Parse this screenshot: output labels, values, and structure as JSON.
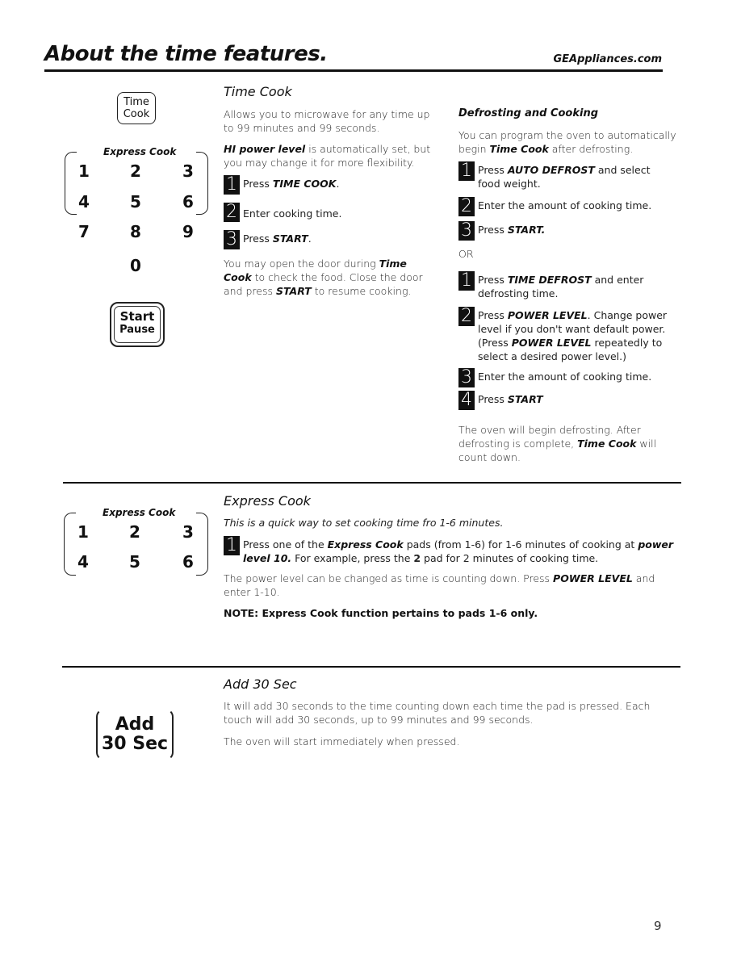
{
  "header": {
    "title": "About the time features.",
    "site": "GEAppliances.com"
  },
  "keypad": {
    "time_cook_button": [
      "Time",
      "Cook"
    ],
    "express_label": "Express Cook",
    "keys": [
      "1",
      "2",
      "3",
      "4",
      "5",
      "6",
      "7",
      "8",
      "9",
      "0"
    ],
    "start_pause_button": [
      "Start",
      "Pause"
    ]
  },
  "time_cook": {
    "heading": "Time Cook",
    "intro": "Allows you to microwave for any time up to 99 minutes and 99 seconds.",
    "power_bold": "HI power level",
    "power_rest": " is automatically set, but you may change it for more flexibility.",
    "steps": [
      {
        "num": "1",
        "pre": "Press ",
        "bold": "TIME COOK",
        "post": "."
      },
      {
        "num": "2",
        "pre": "Enter cooking time.",
        "bold": "",
        "post": ""
      },
      {
        "num": "3",
        "pre": "Press ",
        "bold": "START",
        "post": "."
      }
    ],
    "door_pre": "You may open the door during ",
    "door_bold": "Time Cook",
    "door_mid": " to check the food. Close the door and press ",
    "door_bold2": "START",
    "door_post": " to resume cooking."
  },
  "defrost": {
    "heading": "Defrosting and Cooking",
    "intro_pre": "You can program the oven to automatically begin ",
    "intro_bold": "Time Cook",
    "intro_post": " after defrosting.",
    "steps_a": [
      {
        "num": "1",
        "pre": "Press ",
        "bold": "AUTO DEFROST",
        "post": " and select food weight."
      },
      {
        "num": "2",
        "pre": "Enter the amount of cooking time.",
        "bold": "",
        "post": ""
      },
      {
        "num": "3",
        "pre": "Press ",
        "bold": "START.",
        "post": ""
      }
    ],
    "or": "OR",
    "steps_b": [
      {
        "num": "1",
        "pre": "Press ",
        "bold": "TIME DEFROST",
        "post": " and enter defrosting time."
      },
      {
        "num": "2",
        "pre": "Press ",
        "bold": "POWER LEVEL",
        "post": ". Change power level if you don't want default power. (Press ",
        "bold2": "POWER LEVEL",
        "post2": " repeatedly to select a desired power level.)"
      },
      {
        "num": "3",
        "pre": "Enter the amount of cooking time.",
        "bold": "",
        "post": ""
      },
      {
        "num": "4",
        "pre": "Press ",
        "bold": "START",
        "post": ""
      }
    ],
    "outro_pre": "The oven will begin defrosting. After defrosting is complete, ",
    "outro_bold": "Time Cook",
    "outro_post": " will count down."
  },
  "express_cook": {
    "keypad_label": "Express Cook",
    "keys": [
      "1",
      "2",
      "3",
      "4",
      "5",
      "6"
    ],
    "heading": "Express Cook",
    "intro": "This is a quick way to set cooking time fro 1-6 minutes.",
    "step": {
      "num": "1",
      "pre": "Press one of the ",
      "bold": "Express Cook",
      "mid": " pads (from 1-6) for 1-6 minutes of cooking at ",
      "bold2": "power level 10.",
      "mid2": "  For example, press the ",
      "bold3": "2",
      "post": " pad for 2 minutes of cooking time."
    },
    "power_pre": "The power level can be changed as time is counting down.  Press ",
    "power_bold": "POWER LEVEL",
    "power_post": " and enter 1-10.",
    "note": "NOTE:  Express Cook function pertains to pads 1-6 only."
  },
  "add30": {
    "button": [
      "Add",
      "30 Sec"
    ],
    "heading": "Add 30 Sec",
    "p1": "It will add 30 seconds to the time counting down each time the pad is pressed.   Each touch will add 30 seconds, up to 99 minutes and 99 seconds.",
    "p2": "The oven will start immediately when pressed."
  },
  "footer": {
    "page_number": "9"
  }
}
